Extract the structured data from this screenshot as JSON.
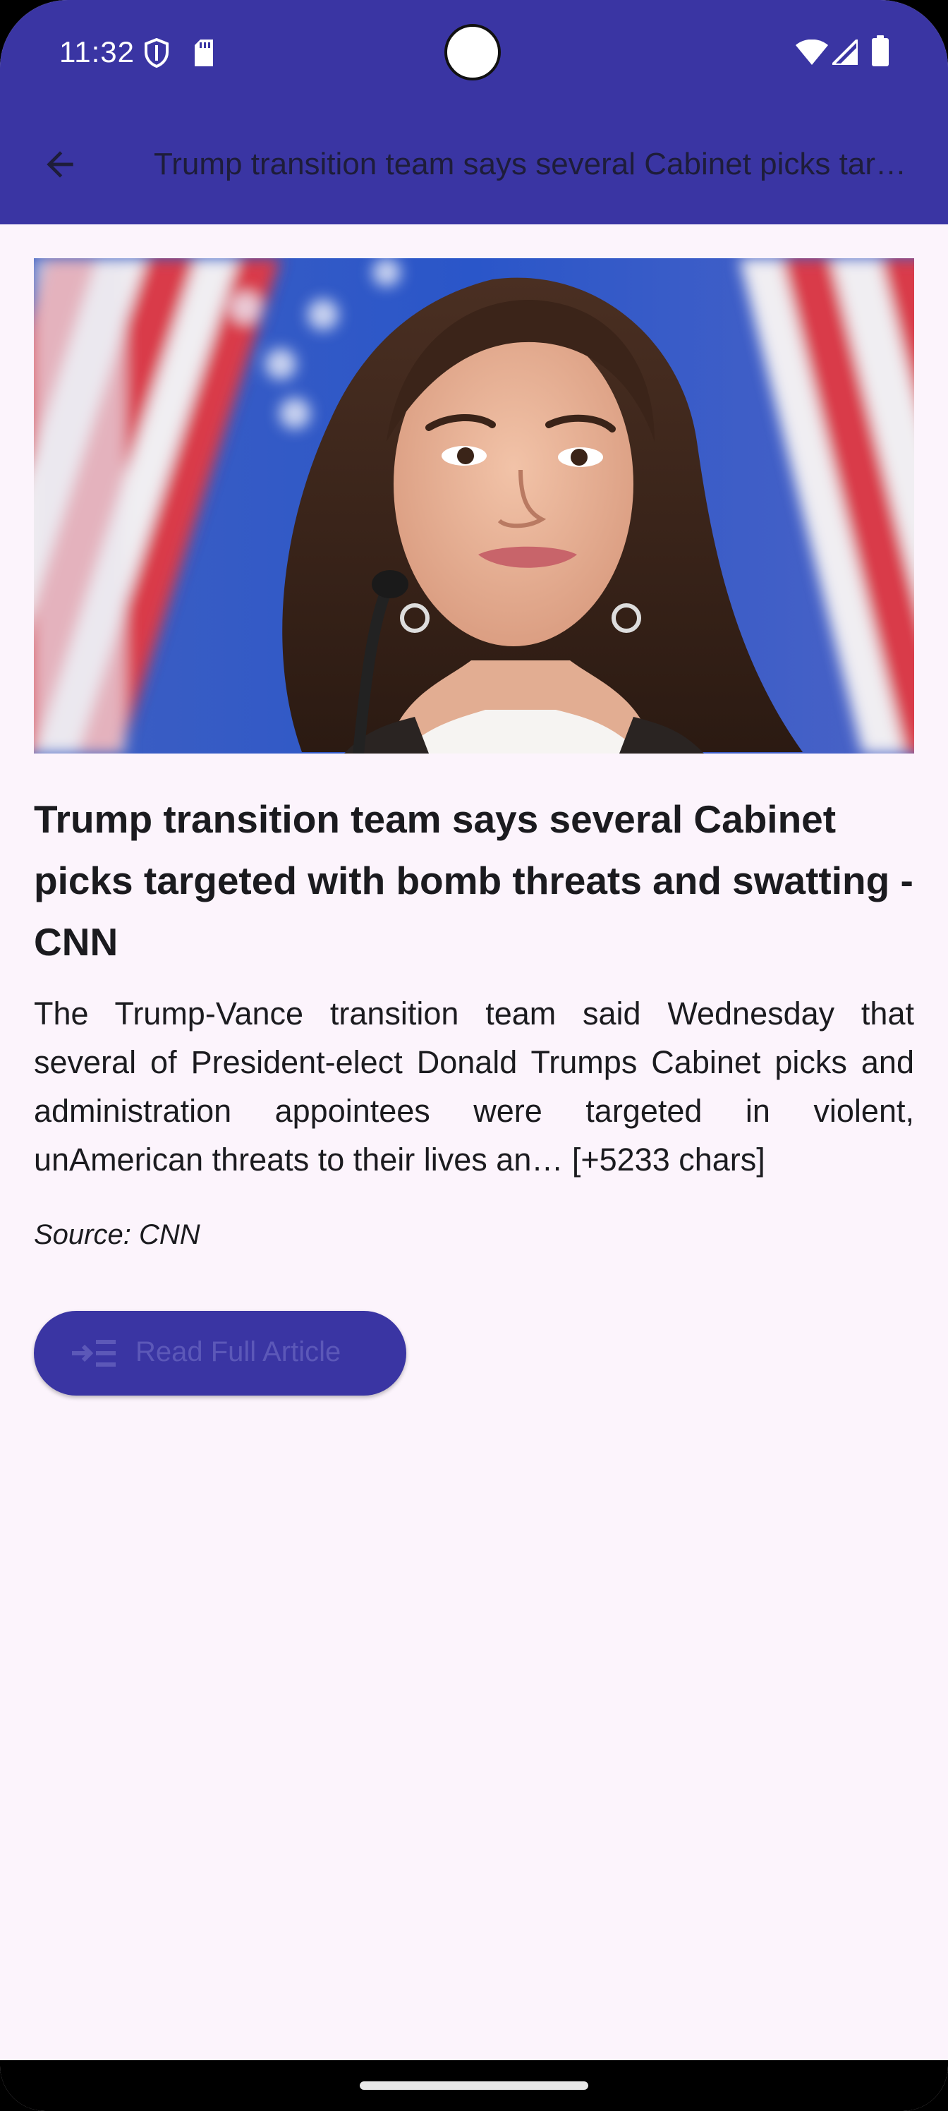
{
  "status_bar": {
    "time": "11:32",
    "icons": [
      "shield-icon",
      "sd-card-icon",
      "wifi-icon",
      "cell-signal-icon",
      "battery-icon"
    ],
    "background_color": "#3a35a3"
  },
  "app_bar": {
    "title": "Trump transition team says several Cabinet picks targeted with bomb threats and swatting - CNN",
    "back_icon": "arrow-left-icon",
    "background_color": "#3a35a3"
  },
  "article": {
    "image_alt": "Photo of a woman speaking at a podium in front of American flags",
    "headline": "Trump transition team says several Cabinet picks targeted with bomb threats and swatting - CNN",
    "description": "The Trump-Vance transition team said Wednesday that several of President-elect Donald Trumps Cabinet picks and administration appointees were targeted in violent, unAmerican threats to their lives an… [+5233 chars]",
    "source": "Source: CNN"
  },
  "actions": {
    "read_full_label": "Read Full Article",
    "read_full_icon": "read-more-icon",
    "button_color": "#3a35a3"
  },
  "colors": {
    "page_background": "#fcf4fc",
    "text": "#1b1b1f"
  }
}
